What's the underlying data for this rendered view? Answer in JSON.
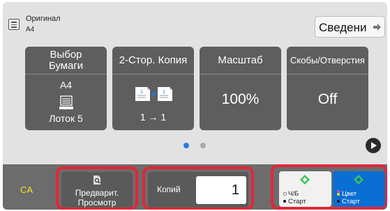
{
  "header": {
    "original_title": "Оригинал",
    "original_size": "A4",
    "details_label": "Сведени",
    "details_icon": "arrow-right-icon"
  },
  "tiles": [
    {
      "label_line1": "Выбор",
      "label_line2": "Бумаги",
      "value": "A4",
      "icon": "paper-tray-icon",
      "sub": "Лоток 5"
    },
    {
      "label": "2-Стор. Копия",
      "icon": "duplex-icon",
      "sub": "1 → 1"
    },
    {
      "label": "Масштаб",
      "value": "100%"
    },
    {
      "label": "Скобы/Отверстия",
      "value": "Off"
    }
  ],
  "pagination": {
    "pages": 2,
    "current": 1,
    "active_color": "#2a7de1"
  },
  "footer": {
    "ca_label": "CA",
    "preview_line1": "Предварит.",
    "preview_line2": "Просмотр",
    "copies_label": "Копий",
    "copies_value": "1",
    "start_bw_line1": "Ч/Б",
    "start_bw_line2": "Старт",
    "start_color_line1": "Цвет",
    "start_color_line2": "Старт"
  },
  "colors": {
    "highlight": "#e32638",
    "start_green": "#3cc25a",
    "color_start_bg": "#0a6fd3",
    "ca_text": "#f7e21c"
  }
}
